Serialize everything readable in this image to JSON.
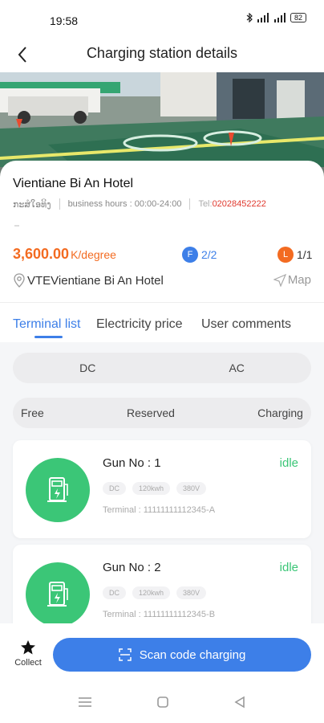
{
  "status_bar": {
    "time": "19:58",
    "battery": "82"
  },
  "header": {
    "title": "Charging station details"
  },
  "station": {
    "name": "Vientiane Bi An Hotel",
    "meta_short": "ກະສໍໃອທິງ",
    "business_hours": "business hours : 00:00-24:00",
    "tel_label": "Tel:",
    "tel_value": "02028452222",
    "price_value": "3,600.00",
    "price_unit": "K/degree",
    "fast_label": "F",
    "fast_count": "2/2",
    "slow_label": "L",
    "slow_count": "1/1",
    "address": "VTEVientiane Bi An Hotel",
    "map_label": "Map"
  },
  "tabs": [
    {
      "label": "Terminal list",
      "active": true
    },
    {
      "label": "Electricity price",
      "active": false
    },
    {
      "label": "User comments",
      "active": false
    }
  ],
  "type_filter": [
    "DC",
    "AC"
  ],
  "status_filter": [
    "Free",
    "Reserved",
    "Charging"
  ],
  "guns": [
    {
      "title": "Gun No : 1",
      "status": "idle",
      "tags": [
        "DC",
        "120kwh",
        "380V"
      ],
      "terminal": "Terminal : 11111111112345-A"
    },
    {
      "title": "Gun No : 2",
      "status": "idle",
      "tags": [
        "DC",
        "120kwh",
        "380V"
      ],
      "terminal": "Terminal : 11111111112345-B"
    }
  ],
  "bottom": {
    "collect_label": "Collect",
    "scan_label": "Scan code charging"
  },
  "colors": {
    "accent": "#3d7fe8",
    "price": "#f36b21",
    "idle": "#3bc677",
    "tel": "#e03a2f"
  }
}
